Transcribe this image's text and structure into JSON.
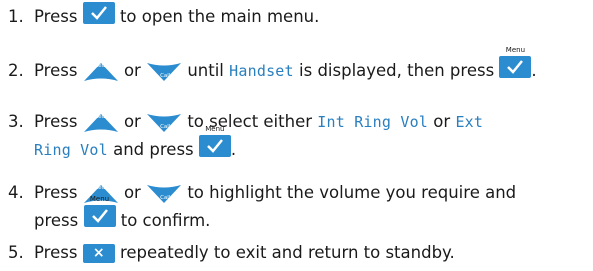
{
  "keys": {
    "menu_caption": "Menu",
    "redial_caption": "Redial",
    "calls_caption": "Calls",
    "close_symbol": "×"
  },
  "steps": [
    {
      "number": "1.",
      "parts": [
        "Press",
        "to open the main menu."
      ]
    },
    {
      "number": "2.",
      "parts": [
        "Press",
        "or",
        "until",
        "Handset",
        "is displayed, then press",
        "."
      ]
    },
    {
      "number": "3.",
      "parts": [
        "Press",
        "or",
        "to select either",
        "Int Ring Vol",
        "or",
        "Ext",
        "Ring Vol",
        "and press",
        "."
      ]
    },
    {
      "number": "4.",
      "parts": [
        "Press",
        "or",
        "to highlight the volume you require and",
        "press",
        "to confirm."
      ]
    },
    {
      "number": "5.",
      "parts": [
        "Press",
        "repeatedly to exit and return to standby."
      ]
    }
  ],
  "colors": {
    "key_blue": "#2b8ccf",
    "lcd_text": "#2a7fbf"
  }
}
